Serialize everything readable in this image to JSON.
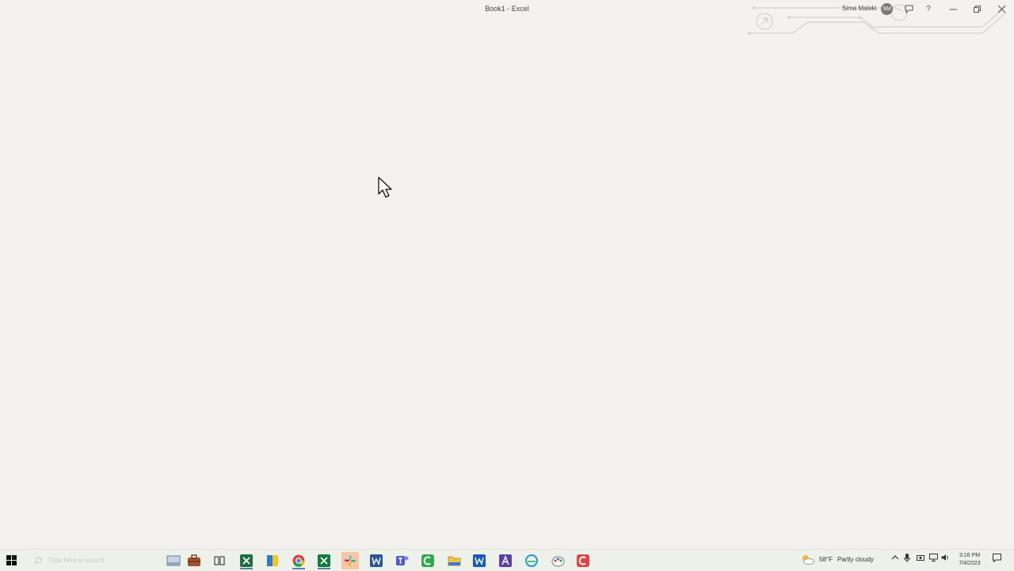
{
  "window": {
    "title": "Book1  -  Excel",
    "user_name": "Sima Maleki",
    "user_initials": "SM",
    "icons": [
      "share-icon",
      "help-icon",
      "minimize-icon",
      "restore-icon",
      "close-icon"
    ],
    "help_glyph": "?"
  },
  "taskbar": {
    "search_placeholder": "Type here to search",
    "apps": [
      "file-explorer-icon",
      "briefcase-icon",
      "task-view-icon",
      "excel-icon",
      "sticky-notes-icon",
      "chrome-icon",
      "excel-icon",
      "slack-icon",
      "word-icon",
      "teams-icon",
      "camtasia-icon",
      "folder-icon",
      "word-icon",
      "adobe-icon",
      "edge-icon",
      "paint-icon",
      "recorder-icon"
    ],
    "weather": {
      "temp": "58°F",
      "condition": "Partly cloudy"
    },
    "time": "3:16 PM",
    "date": "7/4/2023"
  }
}
